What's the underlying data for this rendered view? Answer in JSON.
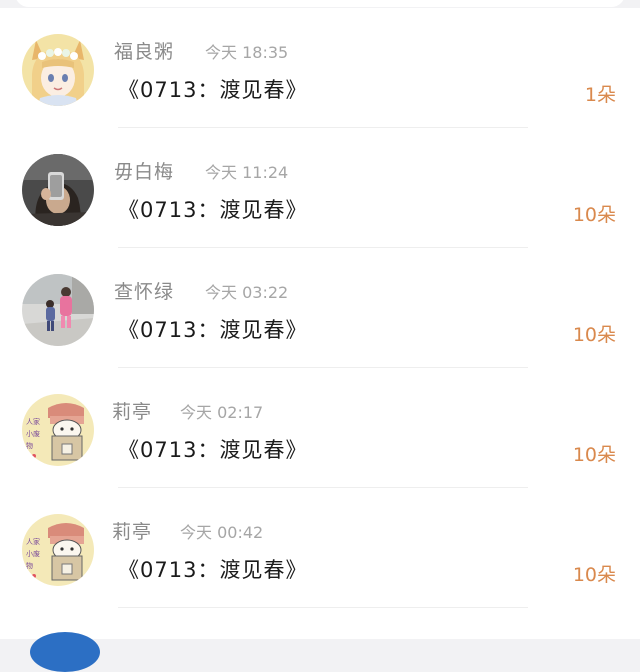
{
  "records": [
    {
      "name": "福良粥",
      "time": "今天 18:35",
      "gift": "《0713：渡见春》",
      "amount": "1朵"
    },
    {
      "name": "毋白梅",
      "time": "今天 11:24",
      "gift": "《0713：渡见春》",
      "amount": "10朵"
    },
    {
      "name": "查怀绿",
      "time": "今天 03:22",
      "gift": "《0713：渡见春》",
      "amount": "10朵"
    },
    {
      "name": "莉亭",
      "time": "今天 02:17",
      "gift": "《0713：渡见春》",
      "amount": "10朵"
    },
    {
      "name": "莉亭",
      "time": "今天 00:42",
      "gift": "《0713：渡见春》",
      "amount": "10朵"
    }
  ],
  "avatars": [
    {
      "icon": "anime-fox-girl-avatar"
    },
    {
      "icon": "mirror-selfie-avatar"
    },
    {
      "icon": "kids-walking-avatar"
    },
    {
      "icon": "cat-in-box-sticker-avatar",
      "sticker_text": "人家是可爱的小废物"
    },
    {
      "icon": "cat-in-box-sticker-avatar",
      "sticker_text": "人家是可爱的小废物"
    }
  ],
  "colors": {
    "amount": "#d9894d",
    "name": "#8a8a8a",
    "text": "#1b1b1b",
    "background": "#ffffff"
  }
}
